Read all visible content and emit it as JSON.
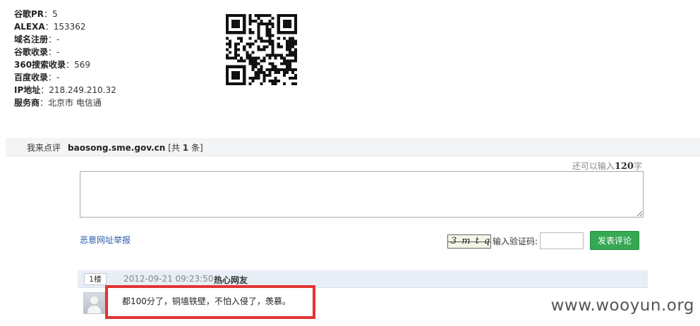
{
  "site_info": {
    "rows": [
      {
        "label": "谷歌PR",
        "value": "5"
      },
      {
        "label": "ALEXA",
        "value": "153362"
      },
      {
        "label": "域名注册",
        "value": "-"
      },
      {
        "label": "谷歌收录",
        "value": "-"
      },
      {
        "label": "360搜索收录",
        "value": "569"
      },
      {
        "label": "百度收录",
        "value": "-"
      },
      {
        "label": "IP地址",
        "value": "218.249.210.32"
      },
      {
        "label": "服务商",
        "value": "北京市 电信通"
      }
    ],
    "separator": "："
  },
  "comments_bar": {
    "prefix": "我来点评",
    "domain": "baosong.sme.gov.cn",
    "count_open": "[共",
    "count": "1",
    "count_close": "条]"
  },
  "form": {
    "remaining_prefix": "还可以输入",
    "remaining_count": "120",
    "remaining_suffix": "字",
    "textarea_value": "",
    "report_link": "恶意网址举报",
    "captcha_text": "3mtq",
    "captcha_label": "输入验证码:",
    "captcha_value": "",
    "submit_label": "发表评论"
  },
  "comments": [
    {
      "floor": "1楼",
      "time": "2012-09-21 09:23:50",
      "author": "热心网友",
      "text": "都100分了，铜墙铁壁，不怕入侵了，羡慕。"
    }
  ],
  "watermark": "www.wooyun.org",
  "colors": {
    "highlight_border": "#e23333",
    "submit_bg": "#35a853",
    "link": "#2a5caa",
    "comment_header_bg": "#e8eef5"
  },
  "icons": {
    "avatar": "default-user-avatar",
    "qr": "qr-code"
  }
}
